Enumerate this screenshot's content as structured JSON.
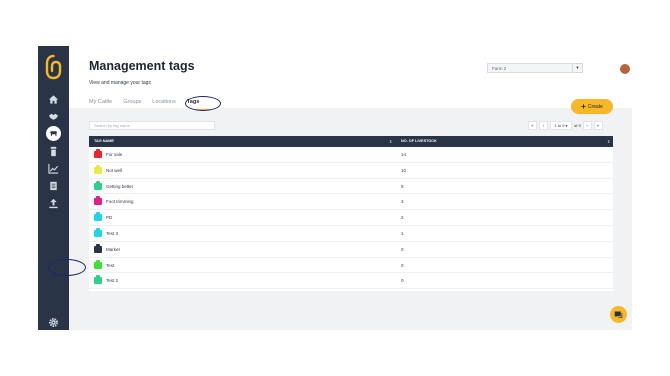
{
  "header": {
    "title": "Management tags",
    "subtitle": "View and manage your tags",
    "farm_select": "Farm 2",
    "avatar_initial": "L"
  },
  "tabs": [
    {
      "label": "My Cattle",
      "active": false
    },
    {
      "label": "Groups",
      "active": false
    },
    {
      "label": "Locations",
      "active": false
    },
    {
      "label": "Tags",
      "active": true
    }
  ],
  "create_label": "Create",
  "search": {
    "placeholder": "Search by tag name"
  },
  "pagination": {
    "range": "1 to 9",
    "of": "of 9"
  },
  "table": {
    "columns": [
      "TAG NAME",
      "NO. OF LIVESTOCK"
    ],
    "rows": [
      {
        "name": "For sale",
        "count": "14",
        "color": "#e8262b"
      },
      {
        "name": "Not well",
        "count": "10",
        "color": "#e9ea43"
      },
      {
        "name": "Getting better",
        "count": "5",
        "color": "#2ed18b"
      },
      {
        "name": "Foot trimming",
        "count": "3",
        "color": "#e61e8c"
      },
      {
        "name": "PD",
        "count": "2",
        "color": "#1fd6e6"
      },
      {
        "name": "Test 3",
        "count": "1",
        "color": "#1fd6e6"
      },
      {
        "name": "Market",
        "count": "0",
        "color": "#2a3447"
      },
      {
        "name": "Test",
        "count": "0",
        "color": "#3ae23a"
      },
      {
        "name": "Test 2",
        "count": "0",
        "color": "#2ed18b"
      }
    ]
  },
  "colors": {
    "sidebar": "#2a3447",
    "accent": "#f5b829",
    "annotation": "#1f2670"
  },
  "icons": {
    "sidebar": [
      "home-icon",
      "handshake-icon",
      "cow-icon",
      "feed-icon",
      "analytics-icon",
      "clipboard-icon",
      "upload-icon",
      "settings-icon"
    ]
  }
}
